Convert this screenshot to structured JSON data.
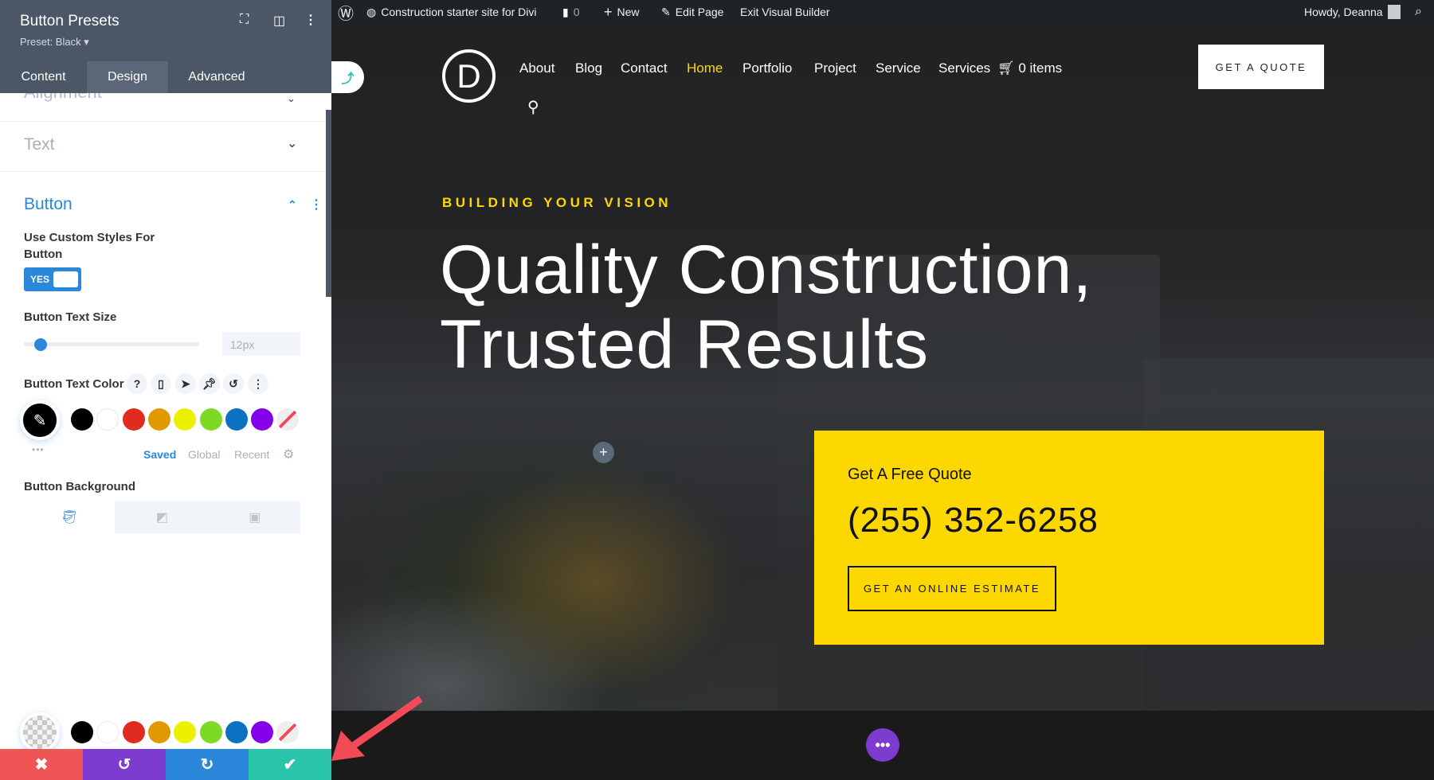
{
  "panel": {
    "title": "Button Presets",
    "preset": "Preset: Black ▾",
    "tabs": [
      {
        "label": "Content"
      },
      {
        "label": "Design",
        "active": true
      },
      {
        "label": "Advanced"
      }
    ],
    "sections": {
      "alignment": "Alignment",
      "text": "Text",
      "button": "Button"
    },
    "custom_styles_label_1": "Use Custom Styles For",
    "custom_styles_label_2": "Button",
    "toggle_value": "YES",
    "text_size_label": "Button Text Size",
    "text_size_value": "12px",
    "text_size_slider_fraction": 0.05,
    "text_color_label": "Button Text Color",
    "swatches": [
      "#000000",
      "#ffffff",
      "#e02b20",
      "#e09900",
      "#edf000",
      "#7cda24",
      "#0c71c3",
      "#8300e9",
      "transparent"
    ],
    "palette_tabs": {
      "saved": "Saved",
      "global": "Global",
      "recent": "Recent"
    },
    "background_label": "Button Background",
    "accent": "#2b87da",
    "bottom_buttons": [
      {
        "name": "discard",
        "icon": "✖",
        "color": "#ef5555"
      },
      {
        "name": "undo",
        "icon": "↺",
        "color": "#7e3bd0"
      },
      {
        "name": "redo",
        "icon": "↻",
        "color": "#2b87da"
      },
      {
        "name": "save",
        "icon": "✔",
        "color": "#29c4a9"
      }
    ]
  },
  "adminbar": {
    "site": "Construction starter site for Divi",
    "comments": "0",
    "new": "New",
    "edit": "Edit Page",
    "exit": "Exit Visual Builder",
    "howdy": "Howdy, Deanna"
  },
  "site": {
    "logo": "D",
    "nav": [
      "About",
      "Blog",
      "Contact",
      "Home",
      "Portfolio",
      "Project",
      "Service",
      "Services"
    ],
    "active_nav": "Home",
    "cart": "0 items",
    "cta": "GET A QUOTE",
    "eyebrow": "BUILDING YOUR VISION",
    "headline_1": "Quality Construction,",
    "headline_2": "Trusted Results",
    "quote_title": "Get A Free Quote",
    "phone": "(255) 352-6258",
    "estimate": "GET AN ONLINE ESTIMATE",
    "accent": "#fcd800"
  }
}
